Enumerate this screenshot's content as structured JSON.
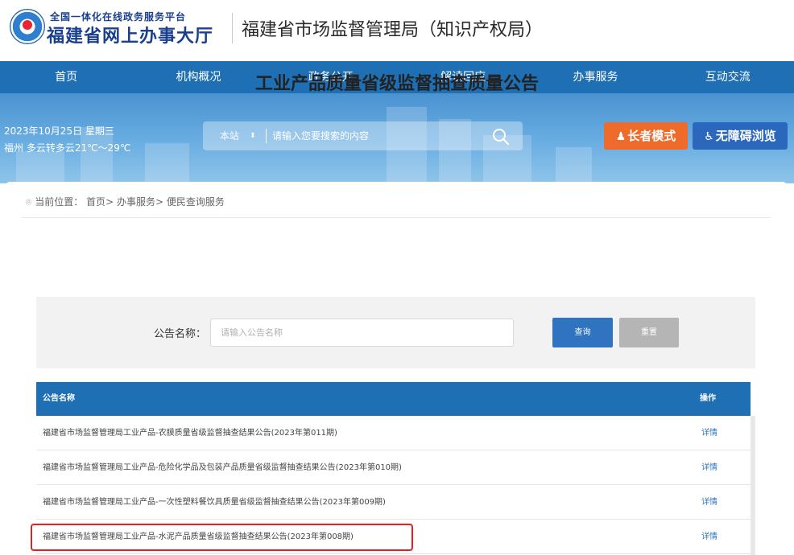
{
  "header": {
    "logo_subtitle": "全国一体化在线政务服务平台",
    "logo_title": "福建省网上办事大厅",
    "org_title": "福建省市场监督管理局（知识产权局）"
  },
  "nav": [
    "首页",
    "机构概况",
    "政务公开",
    "解读回应",
    "办事服务",
    "互动交流"
  ],
  "banner": {
    "date": "2023年10月25日 星期三",
    "weather": "福州 多云转多云21℃～29℃",
    "search_scope": "本站",
    "search_placeholder": "请输入您要搜索的内容",
    "elder_mode_label": "长者模式",
    "accessibility_label": "无障碍浏览"
  },
  "breadcrumb": {
    "prefix": "当前位置：",
    "items": [
      "首页",
      "办事服务",
      "便民查询服务"
    ],
    "separator": ">"
  },
  "page_title": "工业产品质量省级监督抽查质量公告",
  "filter": {
    "label": "公告名称：",
    "placeholder": "请输入公告名称",
    "query_label": "查询",
    "reset_label": "重置"
  },
  "table": {
    "columns": [
      "公告名称",
      "操作"
    ],
    "rows": [
      {
        "title": "福建省市场监督管理局工业产品-农膜质量省级监督抽查结果公告(2023年第011期)",
        "action": "详情"
      },
      {
        "title": "福建省市场监督管理局工业产品-危险化学品及包装产品质量省级监督抽查结果公告(2023年第010期)",
        "action": "详情"
      },
      {
        "title": "福建省市场监督管理局工业产品-一次性塑料餐饮具质量省级监督抽查结果公告(2023年第009期)",
        "action": "详情"
      },
      {
        "title": "福建省市场监督管理局工业产品-水泥产品质量省级监督抽查结果公告(2023年第008期)",
        "action": "详情"
      }
    ]
  },
  "colors": {
    "nav_blue": "#1f6fb4",
    "elder_orange": "#ef6b2b",
    "access_blue": "#2b67bc",
    "query_blue": "#2f73c1",
    "highlight_red": "#e52020"
  }
}
